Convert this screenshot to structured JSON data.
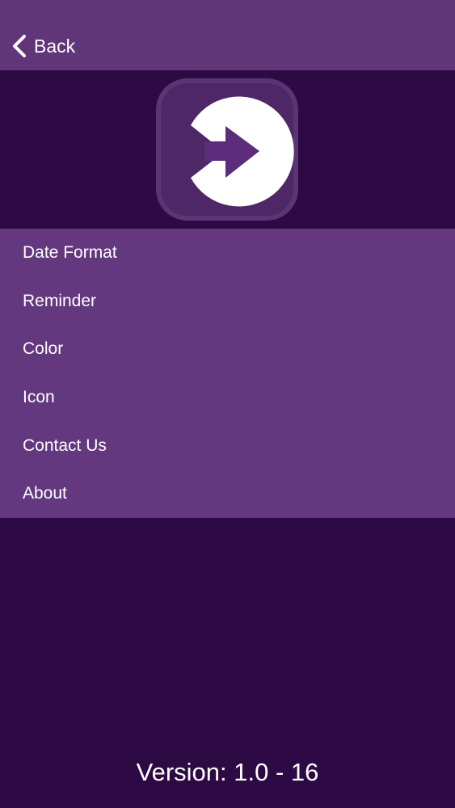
{
  "nav": {
    "back_label": "Back"
  },
  "colors": {
    "nav_background": "#603679",
    "page_background": "#2e0a45",
    "menu_background": "#64387e",
    "icon_tile": "#4d2766",
    "icon_frame": "#5b3475",
    "text": "#ffffff"
  },
  "menu": {
    "items": [
      {
        "label": "Date Format"
      },
      {
        "label": "Reminder"
      },
      {
        "label": "Color"
      },
      {
        "label": "Icon"
      },
      {
        "label": "Contact Us"
      },
      {
        "label": "About"
      }
    ]
  },
  "footer": {
    "version": "Version: 1.0 - 16"
  }
}
